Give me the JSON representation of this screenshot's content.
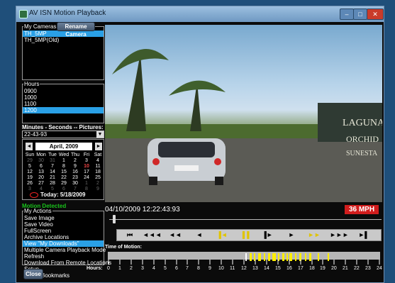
{
  "window": {
    "title": "AV ISN Motion Playback"
  },
  "cameras": {
    "legend": "My Cameras",
    "rename_label": "Rename Camera",
    "items": [
      "TH_5MP",
      "TH_5MP(Old)"
    ]
  },
  "hours": {
    "legend": "Hours",
    "items": [
      "0900",
      "1000",
      "1100",
      "1200"
    ]
  },
  "minutes": {
    "label": "Minutes - Seconds -- Pictures:",
    "selected": "22-43-93"
  },
  "calendar": {
    "month": "April, 2009",
    "prev_label": "◄",
    "next_label": "►",
    "days": [
      "Sun",
      "Mon",
      "Tue",
      "Wed",
      "Thu",
      "Fri",
      "Sat"
    ],
    "weeks": [
      [
        "29",
        "30",
        "31",
        "1",
        "2",
        "3",
        "4"
      ],
      [
        "5",
        "6",
        "7",
        "8",
        "9",
        "10",
        "11"
      ],
      [
        "12",
        "13",
        "14",
        "15",
        "16",
        "17",
        "18"
      ],
      [
        "19",
        "20",
        "21",
        "22",
        "23",
        "24",
        "25"
      ],
      [
        "26",
        "27",
        "28",
        "29",
        "30",
        "1",
        "2"
      ],
      [
        "3",
        "4",
        "5",
        "6",
        "7",
        "8",
        "9"
      ]
    ],
    "today_label": "Today: 5/18/2009"
  },
  "status": {
    "text": "Motion Detected",
    "color": "#19c21b"
  },
  "actions": {
    "legend": "My Actions",
    "items": [
      "Save Image",
      "Save Video",
      "FullScreen",
      "Archive Locations",
      "View \"My Downloads\"",
      "Multiple Camera Playback Mode",
      "Refresh",
      "Download From Remote Locations",
      "Setup",
      "Radar Bookmarks"
    ]
  },
  "close_label": "Close",
  "video": {
    "timestamp": "04/10/2009  12:22:43:93",
    "speed": "36 MPH"
  },
  "transport": [
    {
      "glyph": "⏮",
      "name": "skip-start"
    },
    {
      "glyph": "◄◄◄",
      "name": "fast-rewind"
    },
    {
      "glyph": "◄◄",
      "name": "rewind"
    },
    {
      "glyph": "◄",
      "name": "step-back"
    },
    {
      "glyph": "▐◄",
      "name": "motion-back"
    },
    {
      "glyph": "▐▐",
      "name": "pause"
    },
    {
      "glyph": "▐►",
      "name": "frame-forward"
    },
    {
      "glyph": "►",
      "name": "play"
    },
    {
      "glyph": "►►",
      "name": "motion-forward"
    },
    {
      "glyph": "►►►",
      "name": "fast-forward"
    },
    {
      "glyph": "►▌",
      "name": "skip-end"
    }
  ],
  "timeline": {
    "label": "Time of Motion:",
    "hours_label": "Hours:",
    "hour_ticks": [
      "0",
      "1",
      "2",
      "3",
      "4",
      "5",
      "6",
      "7",
      "8",
      "9",
      "10",
      "11",
      "12",
      "13",
      "14",
      "15",
      "16",
      "17",
      "18",
      "19",
      "20",
      "21",
      "22",
      "23",
      "24"
    ],
    "playhead_hour": 12.2
  }
}
